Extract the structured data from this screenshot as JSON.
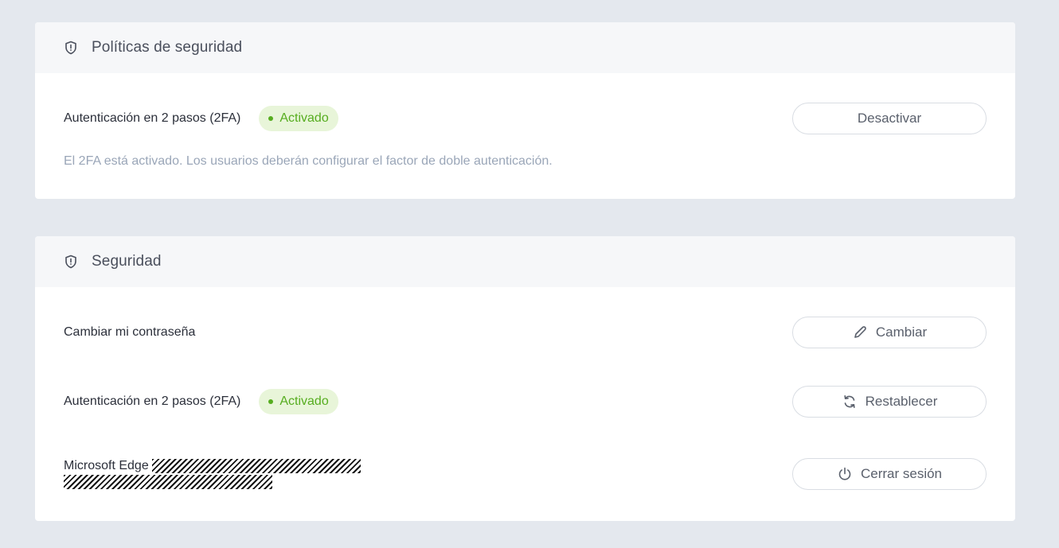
{
  "security_policies": {
    "title": "Políticas de seguridad",
    "twofa_label": "Autenticación en 2 pasos (2FA)",
    "twofa_status": "Activado",
    "deactivate_button": "Desactivar",
    "hint": "El 2FA está activado. Los usuarios deberán configurar el factor de doble autenticación."
  },
  "security": {
    "title": "Seguridad",
    "password_label": "Cambiar mi contraseña",
    "change_button": "Cambiar",
    "twofa_label": "Autenticación en 2 pasos (2FA)",
    "twofa_status": "Activado",
    "reset_button": "Restablecer",
    "session_label": "Microsoft Edge",
    "logout_button": "Cerrar sesión"
  },
  "icons": {
    "header": "shield-icon",
    "change": "pencil-icon",
    "reset": "refresh-icon",
    "logout": "power-icon"
  },
  "colors": {
    "accent_green": "#56ad1f",
    "badge_bg": "#e8f5d9",
    "hint_text": "#9aa6b8",
    "page_bg": "#e4e8ee"
  }
}
